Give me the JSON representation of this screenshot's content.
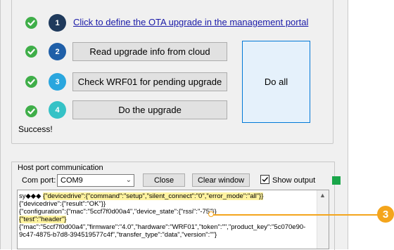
{
  "upgrade": {
    "link_text": "Click to define the OTA upgrade in the management portal",
    "steps": [
      {
        "number": "1",
        "label": "",
        "color": "#1f3a5c"
      },
      {
        "number": "2",
        "label": "Read upgrade info from cloud",
        "color": "#1f5fa8"
      },
      {
        "number": "3",
        "label": "Check WRF01 for pending upgrade",
        "color": "#2aa6de"
      },
      {
        "number": "4",
        "label": "Do the upgrade",
        "color": "#35c2c6"
      }
    ],
    "do_all_label": "Do all",
    "status_text": "Success!",
    "check_color": "#3fae49"
  },
  "host": {
    "title": "Host port communication",
    "com_port_label": "Com port:",
    "com_port_value": "COM9",
    "close_label": "Close",
    "clear_label": "Clear window",
    "show_output_label": "Show output",
    "show_output_checked": true,
    "indicator_color": "#1aa64a"
  },
  "console": {
    "lines": [
      {
        "prefix": "sy◆◆◆ ",
        "text": "{\"devicedrive\":{\"command\":\"setup\",\"silent_connect\":\"0\",\"error_mode\":\"all\"}}"
      },
      {
        "prefix": "",
        "text": "{\"devicedrive\":{\"result\":\"OK\"}}"
      },
      {
        "prefix": "",
        "text": "{\"configuration\":{\"mac\":\"5ccf7f0d00a4\",\"device_state\":{\"rssi\":\"-75\"}}"
      },
      {
        "prefix": "",
        "text": "{\"test\":\"header\"}"
      },
      {
        "prefix": "",
        "text": "{\"mac\":\"5ccf7f0d00a4\",\"firmware\":\"4.0\",\"hardware\":\"WRF01\",\"token\":\"\",\"product_key\":\"5c070e90-"
      },
      {
        "prefix": "",
        "text": "9c47-4875-b7d8-394519577c4f\",\"transfer_type\":\"data\",\"version\":\"\"}"
      }
    ]
  },
  "annotation": {
    "callout_number": "3",
    "callout_color": "#f4a51c"
  }
}
